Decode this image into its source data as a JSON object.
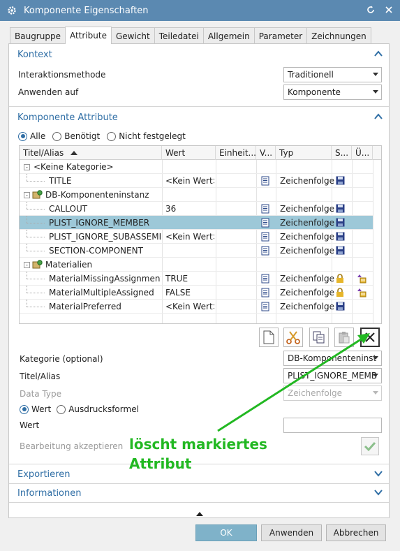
{
  "window": {
    "title": "Komponente Eigenschaften"
  },
  "tabs": [
    "Baugruppe",
    "Attribute",
    "Gewicht",
    "Teiledatei",
    "Allgemein",
    "Parameter",
    "Zeichnungen"
  ],
  "kontext": {
    "header": "Kontext",
    "interaktion_label": "Interaktionsmethode",
    "interaktion_value": "Traditionell",
    "anwenden_label": "Anwenden auf",
    "anwenden_value": "Komponente"
  },
  "attribute_section": {
    "header": "Komponente Attribute",
    "filters": [
      "Alle",
      "Benötigt",
      "Nicht festgelegt"
    ],
    "selected_filter": "Alle"
  },
  "table": {
    "columns": [
      "Titel/Alias",
      "Wert",
      "Einheit...",
      "V...",
      "Typ",
      "S...",
      "Ü..."
    ],
    "rows": [
      {
        "kind": "group",
        "title": "<Keine Kategorie>"
      },
      {
        "kind": "item",
        "title": "TITLE",
        "wert": "<Kein Wert>",
        "typ": "Zeichenfolge",
        "s_icon": "save-icon",
        "u_icon": ""
      },
      {
        "kind": "group",
        "title": "DB-Komponenteninstanz"
      },
      {
        "kind": "item",
        "title": "CALLOUT",
        "wert": "36",
        "typ": "Zeichenfolge",
        "s_icon": "save-icon",
        "u_icon": ""
      },
      {
        "kind": "item",
        "title": "PLIST_IGNORE_MEMBER",
        "wert": "",
        "typ": "Zeichenfolge",
        "s_icon": "save-icon",
        "u_icon": "",
        "selected": true
      },
      {
        "kind": "item",
        "title": "PLIST_IGNORE_SUBASSEMBLY",
        "wert": "<Kein Wert>",
        "typ": "Zeichenfolge",
        "s_icon": "save-icon",
        "u_icon": ""
      },
      {
        "kind": "item",
        "title": "SECTION-COMPONENT",
        "wert": "",
        "typ": "Zeichenfolge",
        "s_icon": "save-icon",
        "u_icon": ""
      },
      {
        "kind": "group",
        "title": "Materialien"
      },
      {
        "kind": "item",
        "title": "MaterialMissingAssignments",
        "wert": "TRUE",
        "typ": "Zeichenfolge",
        "s_icon": "lock-icon",
        "u_icon": "inherit-icon"
      },
      {
        "kind": "item",
        "title": "MaterialMultipleAssigned",
        "wert": "FALSE",
        "typ": "Zeichenfolge",
        "s_icon": "lock-icon",
        "u_icon": "inherit-icon"
      },
      {
        "kind": "item",
        "title": "MaterialPreferred",
        "wert": "<Kein Wert>",
        "typ": "Zeichenfolge",
        "s_icon": "save-icon",
        "u_icon": ""
      }
    ]
  },
  "toolbar_icons": [
    "new-document-icon",
    "scissors-icon",
    "copy-icon",
    "paste-icon",
    "delete-icon"
  ],
  "form": {
    "kategorie_label": "Kategorie (optional)",
    "kategorie_value": "DB-Komponenteninst",
    "titel_label": "Titel/Alias",
    "titel_value": "PLIST_IGNORE_MEMB",
    "datatype_label": "Data Type",
    "datatype_value": "Zeichenfolge",
    "wert_modes": [
      "Wert",
      "Ausdrucksformel"
    ],
    "selected_mode": "Wert",
    "wert_label": "Wert",
    "wert_value": "",
    "accept_label": "Bearbeitung akzeptieren"
  },
  "annotation": {
    "line1": "löscht markiertes",
    "line2": "Attribut",
    "color": "#22b822"
  },
  "collapsed_sections": [
    "Exportieren",
    "Informationen"
  ],
  "buttons": {
    "ok": "OK",
    "apply": "Anwenden",
    "cancel": "Abbrechen"
  },
  "colors": {
    "titlebar": "#5b89b1",
    "accent": "#2f6ea5",
    "selection": "#9dc8d8",
    "ok_button": "#7fb2c9"
  }
}
